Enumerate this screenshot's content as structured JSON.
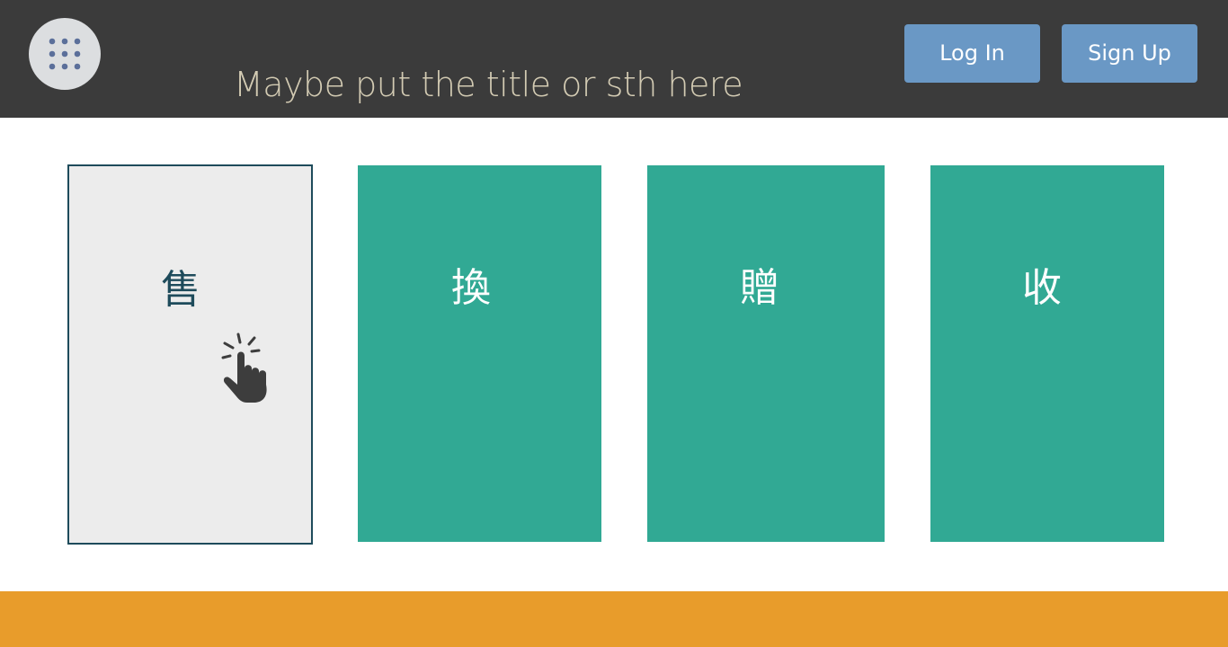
{
  "header": {
    "title": "Maybe put the title or sth here",
    "login_label": "Log In",
    "signup_label": "Sign Up",
    "menu_icon": "grid-dots-icon"
  },
  "cards": [
    {
      "label": "售",
      "state": "selected"
    },
    {
      "label": "換"
    },
    {
      "label": "贈"
    },
    {
      "label": "收"
    }
  ],
  "cursor_icon": "hand-pointer-click-icon",
  "colors": {
    "header_bg": "#3b3b3b",
    "title_text": "#d3cbb3",
    "button_bg": "#6a98c5",
    "card_bg": "#31a994",
    "card_selected_bg": "#ececec",
    "card_selected_border": "#1e4b5b",
    "footer_bg": "#e89c2b"
  }
}
